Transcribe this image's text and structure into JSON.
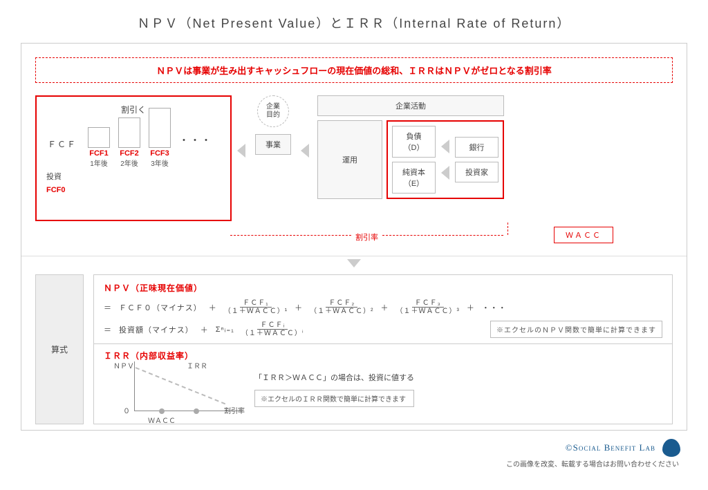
{
  "title": "ＮＰＶ（Net Present Value）とＩＲＲ（Internal Rate of Return）",
  "banner": "ＮＰＶは事業が生み出すキャッシュフローの現在価値の総和、ＩＲＲはＮＰＶがゼロとなる割引率",
  "discount": {
    "title": "割引く",
    "fcf": "ＦＣＦ",
    "bars": [
      "FCF1",
      "FCF2",
      "FCF3"
    ],
    "years": [
      "1年後",
      "2年後",
      "3年後"
    ],
    "invest": "投資",
    "fcf0": "FCF0"
  },
  "center": {
    "purpose": "企業\n目的",
    "business": "事業",
    "rate": "割引率"
  },
  "right": {
    "activity": "企業活動",
    "operation": "運用",
    "debt": "負債\n（D）",
    "equity": "純資本\n（E）",
    "bank": "銀行",
    "investor": "投資家",
    "wacc": "ＷＡＣＣ"
  },
  "formula": {
    "label": "算式",
    "npv_title": "ＮＰＶ（正味現在価値）",
    "eq": "＝",
    "fcf0": "ＦＣＦ０（マイナス）",
    "plus": "＋",
    "f1n": "ＦＣＦ₁",
    "f1d": "（１＋ＷＡＣＣ）¹",
    "f2n": "ＦＣＦ₂",
    "f2d": "（１＋ＷＡＣＣ）²",
    "f3n": "ＦＣＦ₃",
    "f3d": "（１＋ＷＡＣＣ）³",
    "ellipsis": "・・・",
    "inv": "投資額（マイナス）",
    "sigma": "Σⁿᵢ₌₁",
    "fin": "ＦＣＦᵢ",
    "fid": "（１＋ＷＡＣＣ）ⁱ",
    "npv_note": "※エクセルのＮＰＶ関数で簡単に計算できます",
    "irr_title": "ＩＲＲ（内部収益率）",
    "npv_lbl": "ＮＰＶ",
    "zero": "０",
    "wacc_lbl": "ＷＡＣＣ",
    "irr_lbl": "ＩＲＲ",
    "rate_lbl": "割引率",
    "irr_cond": "「ＩＲＲ＞ＷＡＣＣ」の場合は、投資に値する",
    "irr_note": "※エクセルのＩＲＲ関数で簡単に計算できます"
  },
  "footer": {
    "copy": "©Social Benefit Lab",
    "note": "この画像を改変、転載する場合はお問い合わせください"
  }
}
